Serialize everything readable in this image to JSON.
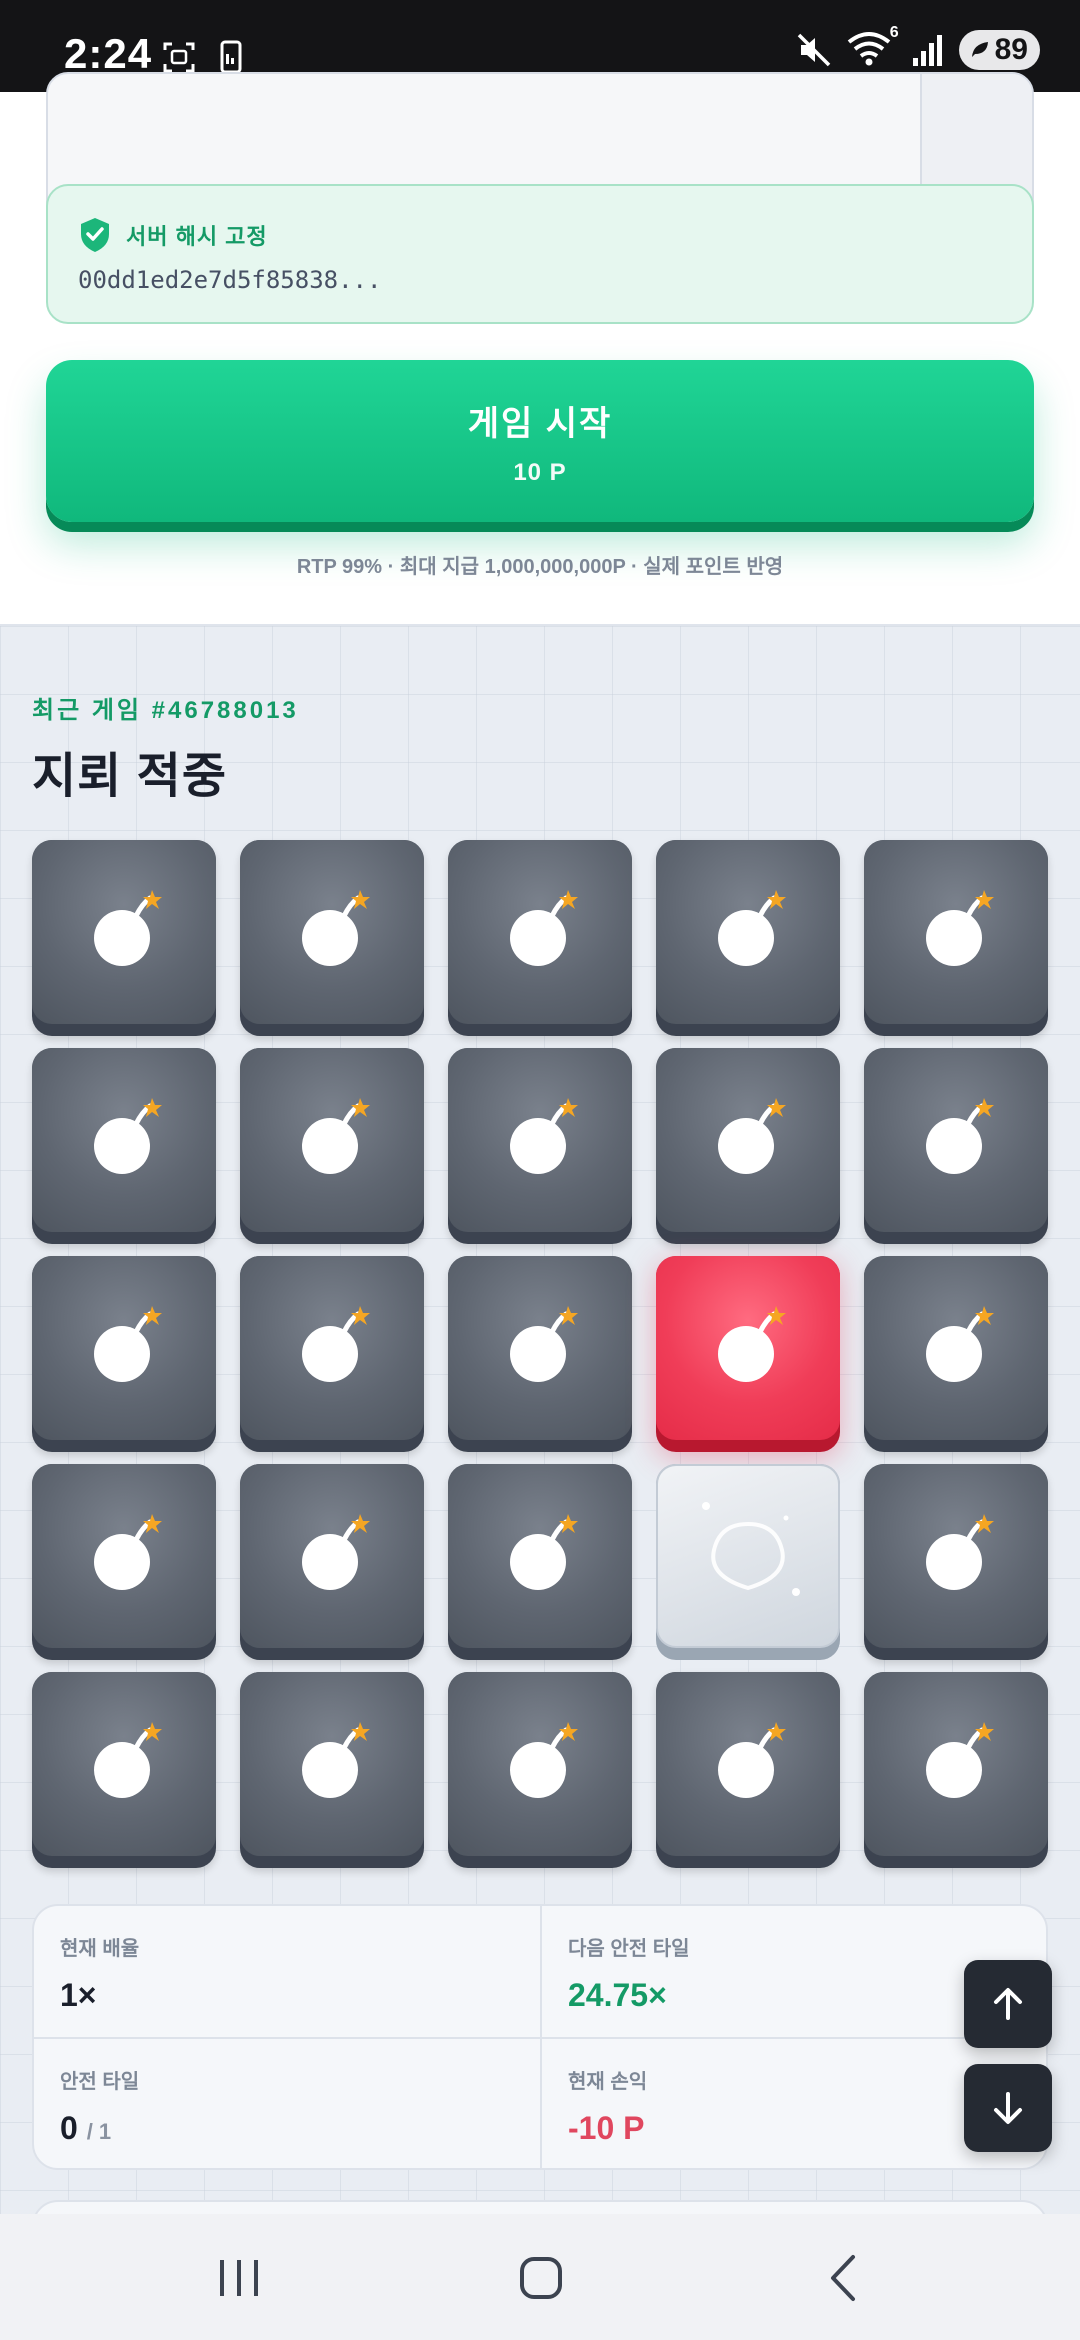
{
  "status_bar": {
    "time": "2:24",
    "battery": "89",
    "wifi_badge": "6"
  },
  "hash": {
    "label": "서버 해시 고정",
    "value": "00dd1ed2e7d5f85838..."
  },
  "start_button": {
    "title": "게임 시작",
    "amount": "10 P"
  },
  "rtp_note": "RTP 99% · 최대 지급 1,000,000,000P · 실제 포인트 반영",
  "recent_game": {
    "label": "최근 게임 #46788013",
    "result": "지뢰 적중"
  },
  "board": {
    "rows": 5,
    "cols": 5,
    "tiles": [
      [
        "mine",
        "mine",
        "mine",
        "mine",
        "mine"
      ],
      [
        "mine",
        "mine",
        "mine",
        "mine",
        "mine"
      ],
      [
        "mine",
        "mine",
        "mine",
        "mine-hit",
        "mine"
      ],
      [
        "mine",
        "mine",
        "mine",
        "gem",
        "mine"
      ],
      [
        "mine",
        "mine",
        "mine",
        "mine",
        "mine"
      ]
    ]
  },
  "stats": {
    "current_multiplier_label": "현재 배율",
    "current_multiplier": "1×",
    "next_safe_label": "다음 안전 타일",
    "next_safe_value": "24.75×",
    "safe_tiles_label": "안전 타일",
    "safe_tiles_value": "0",
    "safe_tiles_total": "/ 1",
    "profit_label": "현재 손익",
    "profit_value": "-10 P"
  },
  "colors": {
    "accent_green": "#149a66",
    "button_green": "#10b87c",
    "mine_hit_red": "#f03d58",
    "loss_red": "#e0475f",
    "tile_dark": "#5f6671"
  },
  "icons": {
    "status": [
      "screenshot-icon",
      "device-icon",
      "mute-icon",
      "wifi-icon",
      "signal-icon",
      "battery-icon"
    ],
    "hash": "shield-check-icon",
    "tile_mine": "bomb-icon",
    "tile_safe": "gem-icon",
    "fab_up": "arrow-up-icon",
    "fab_down": "arrow-down-icon",
    "nav": [
      "recent-apps-icon",
      "home-icon",
      "back-icon"
    ]
  }
}
